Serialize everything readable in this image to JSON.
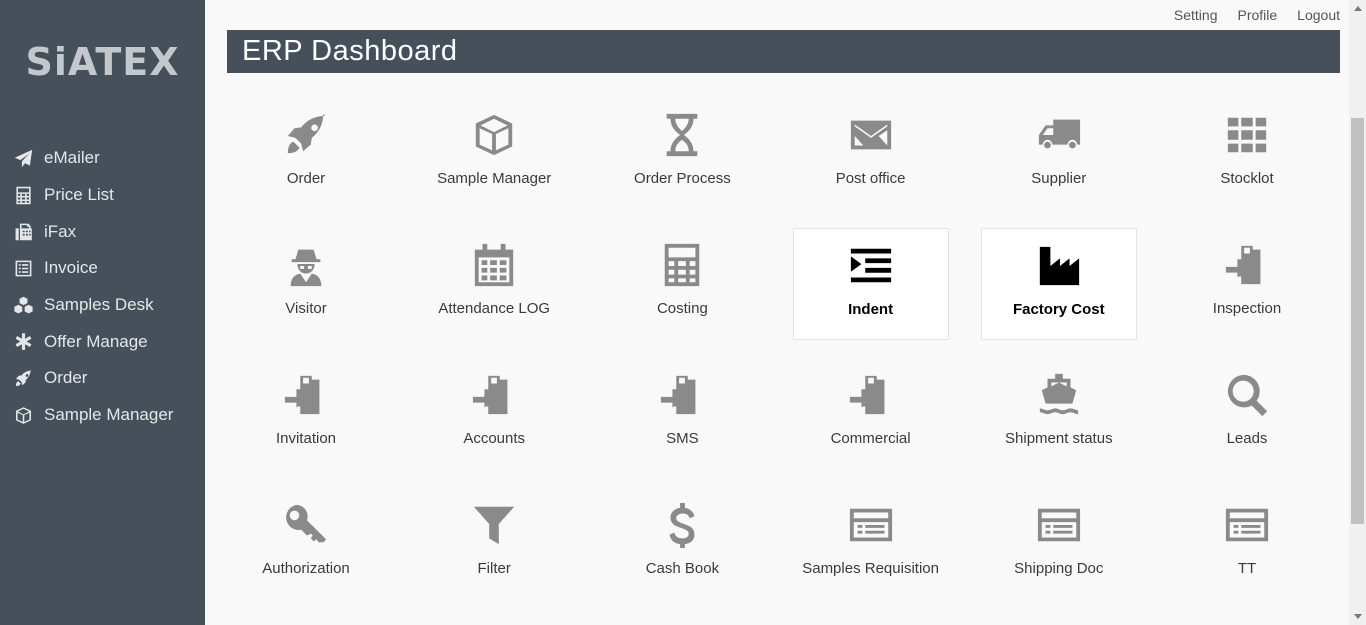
{
  "brand": {
    "logo": "SiATEX"
  },
  "sidebar": {
    "items": [
      {
        "label": "eMailer",
        "icon": "paper-plane-icon"
      },
      {
        "label": "Price List",
        "icon": "calculator-icon"
      },
      {
        "label": "iFax",
        "icon": "fax-icon"
      },
      {
        "label": "Invoice",
        "icon": "list-alt-icon"
      },
      {
        "label": "Samples Desk",
        "icon": "cubes-icon"
      },
      {
        "label": "Offer Manage",
        "icon": "asterisk-icon"
      },
      {
        "label": "Order",
        "icon": "rocket-icon"
      },
      {
        "label": "Sample Manager",
        "icon": "cube-icon"
      }
    ]
  },
  "top_links": {
    "setting": "Setting",
    "profile": "Profile",
    "logout": "Logout"
  },
  "header": {
    "title": "ERP Dashboard"
  },
  "tiles": [
    {
      "label": "Order",
      "icon": "rocket-icon"
    },
    {
      "label": "Sample Manager",
      "icon": "cube-icon"
    },
    {
      "label": "Order Process",
      "icon": "hourglass-icon"
    },
    {
      "label": "Post office",
      "icon": "envelope-icon"
    },
    {
      "label": "Supplier",
      "icon": "truck-icon"
    },
    {
      "label": "Stocklot",
      "icon": "grid-icon"
    },
    {
      "label": "Visitor",
      "icon": "user-secret-icon"
    },
    {
      "label": "Attendance LOG",
      "icon": "calendar-icon"
    },
    {
      "label": "Costing",
      "icon": "calculator-icon"
    },
    {
      "label": "Indent",
      "icon": "indent-icon",
      "active": true
    },
    {
      "label": "Factory Cost",
      "icon": "industry-icon",
      "active": true
    },
    {
      "label": "Inspection",
      "icon": "clipboard-arrow-icon"
    },
    {
      "label": "Invitation",
      "icon": "clipboard-arrow-icon"
    },
    {
      "label": "Accounts",
      "icon": "clipboard-arrow-icon"
    },
    {
      "label": "SMS",
      "icon": "clipboard-arrow-icon"
    },
    {
      "label": "Commercial",
      "icon": "clipboard-arrow-icon"
    },
    {
      "label": "Shipment status",
      "icon": "ship-icon"
    },
    {
      "label": "Leads",
      "icon": "search-icon"
    },
    {
      "label": "Authorization",
      "icon": "key-icon"
    },
    {
      "label": "Filter",
      "icon": "filter-icon"
    },
    {
      "label": "Cash Book",
      "icon": "dollar-icon"
    },
    {
      "label": "Samples Requisition",
      "icon": "list-card-icon"
    },
    {
      "label": "Shipping Doc",
      "icon": "list-card-icon"
    },
    {
      "label": "TT",
      "icon": "list-card-icon"
    }
  ],
  "colors": {
    "sidebar_bg": "#46505a",
    "header_bg": "#46505a",
    "icon_gray": "#8a8a8a",
    "active_icon": "#000000"
  }
}
